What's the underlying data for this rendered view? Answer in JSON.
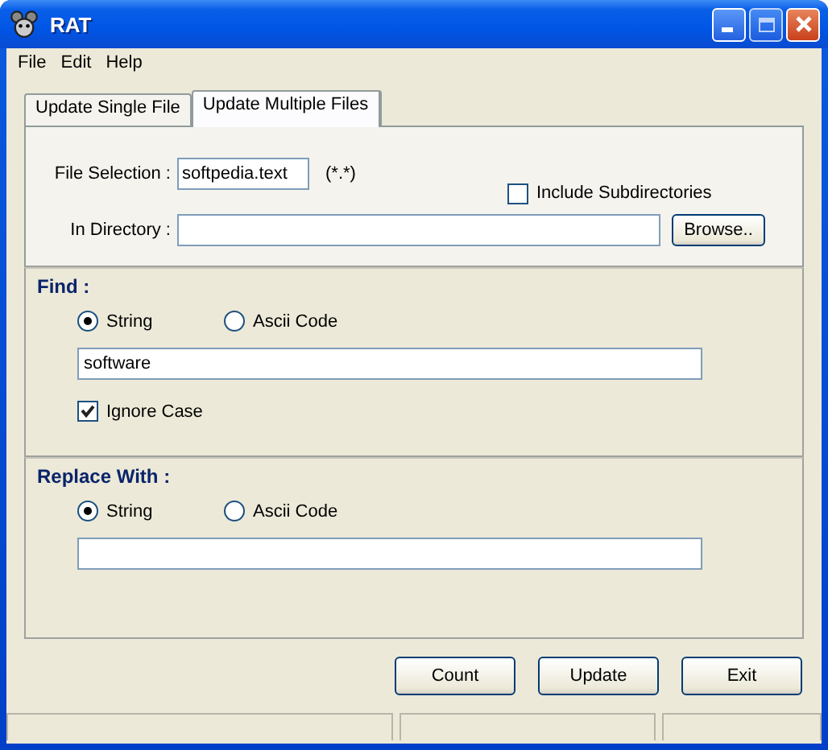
{
  "window": {
    "title": "RAT"
  },
  "menu": [
    "File",
    "Edit",
    "Help"
  ],
  "tabs": [
    {
      "label": "Update Single File",
      "selected": false
    },
    {
      "label": "Update Multiple Files",
      "selected": true
    }
  ],
  "file_selection": {
    "label": "File Selection :",
    "value": "softpedia.text",
    "hint": "(*.*)"
  },
  "include_subdirectories": {
    "label": "Include Subdirectories",
    "checked": false
  },
  "in_directory": {
    "label": "In Directory :",
    "button": "Browse.."
  },
  "find": {
    "title": "Find :",
    "modes": [
      {
        "label": "String",
        "selected": true
      },
      {
        "label": "Ascii Code",
        "selected": false
      }
    ],
    "value": "software",
    "ignore_case": {
      "label": "Ignore Case",
      "checked": true
    }
  },
  "replace": {
    "title": "Replace With :",
    "modes": [
      {
        "label": "String",
        "selected": true
      },
      {
        "label": "Ascii Code",
        "selected": false
      }
    ]
  },
  "buttons": [
    "Count",
    "Update",
    "Exit"
  ]
}
